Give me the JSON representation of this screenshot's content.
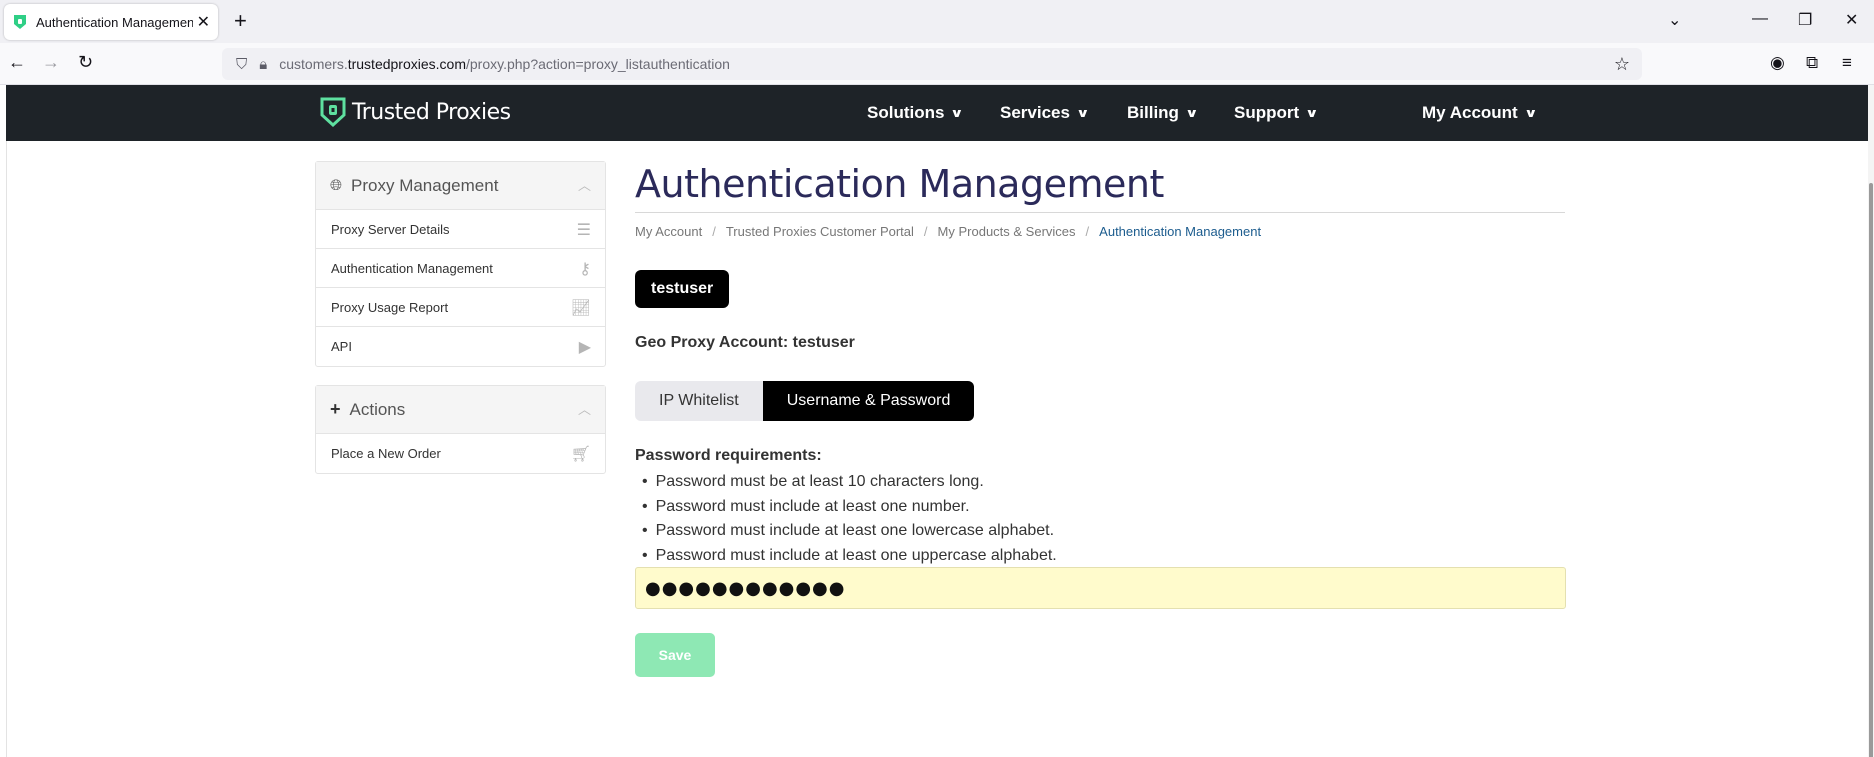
{
  "browser": {
    "tab_title": "Authentication Management - T",
    "url_prefix": "customers.",
    "url_domain": "trustedproxies.com",
    "url_path": "/proxy.php?action=proxy_listauthentication"
  },
  "header": {
    "brand": "Trusted Proxies",
    "menu": [
      "Solutions",
      "Services",
      "Billing",
      "Support",
      "My Account"
    ]
  },
  "sidebar": {
    "proxy_panel": {
      "title": "Proxy Management",
      "items": [
        {
          "label": "Proxy Server Details",
          "icon": "list-icon"
        },
        {
          "label": "Authentication Management",
          "icon": "key-icon"
        },
        {
          "label": "Proxy Usage Report",
          "icon": "chart-icon"
        },
        {
          "label": "API",
          "icon": "play-icon"
        }
      ]
    },
    "actions_panel": {
      "title": "Actions",
      "items": [
        {
          "label": "Place a New Order",
          "icon": "cart-icon"
        }
      ]
    }
  },
  "main": {
    "title": "Authentication Management",
    "breadcrumb": [
      "My Account",
      "Trusted Proxies Customer Portal",
      "My Products & Services",
      "Authentication Management"
    ],
    "user_badge": "testuser",
    "geo_account": "Geo Proxy Account: testuser",
    "tabs": [
      "IP Whitelist",
      "Username & Password"
    ],
    "active_tab": "Username & Password",
    "requirements_title": "Password requirements:",
    "requirements": [
      "Password must be at least 10 characters long.",
      "Password must include at least one number.",
      "Password must include at least one lowercase alphabet.",
      "Password must include at least one uppercase alphabet."
    ],
    "password_value": "●●●●●●●●●●●●",
    "save_label": "Save"
  },
  "colors": {
    "header_bg": "#1e2328",
    "brand_green": "#5ee0a0",
    "title_color": "#2b2a5a",
    "save_disabled": "#8ee8b4",
    "password_bg": "#fffbcc"
  }
}
